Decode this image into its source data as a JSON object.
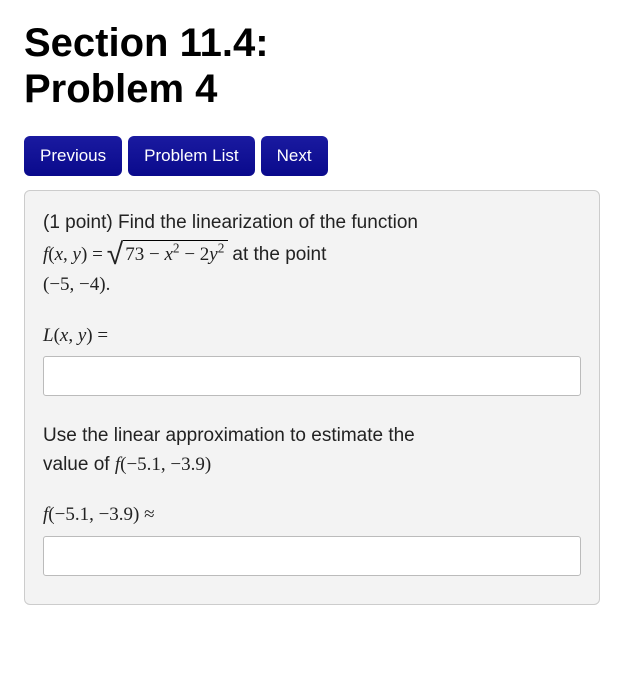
{
  "header": {
    "title_line1": "Section 11.4:",
    "title_line2": "Problem 4"
  },
  "nav": {
    "previous": "Previous",
    "problem_list": "Problem List",
    "next": "Next"
  },
  "problem": {
    "points_label": "(1 point)",
    "intro_text": "Find the linearization of the function",
    "func_lhs_fx": "f",
    "func_lhs_paren_open": "(",
    "func_lhs_x": "x",
    "func_lhs_comma": ", ",
    "func_lhs_y": "y",
    "func_lhs_paren_close": ")",
    "func_eq": " = ",
    "radicand_73": "73",
    "radicand_minus1": " − ",
    "radicand_x": "x",
    "radicand_sq1": "2",
    "radicand_minus2": " − ",
    "radicand_2": "2",
    "radicand_y": "y",
    "radicand_sq2": "2",
    "at_point_text": " at the point",
    "point_text": "(−5, −4).",
    "answer1_label_L": "L",
    "answer1_label_paren_open": "(",
    "answer1_label_x": "x",
    "answer1_label_comma": ", ",
    "answer1_label_y": "y",
    "answer1_label_paren_close": ")",
    "answer1_label_eq": " =",
    "part2_text1": "Use the linear approximation to estimate the",
    "part2_text2": "value of ",
    "part2_f": "f",
    "part2_args_open": "(",
    "part2_args_val": "−5.1, −3.9",
    "part2_args_close": ")",
    "answer2_f": "f",
    "answer2_args_open": "(",
    "answer2_args_val": "−5.1, −3.9",
    "answer2_args_close": ")",
    "answer2_approx": " ≈"
  }
}
